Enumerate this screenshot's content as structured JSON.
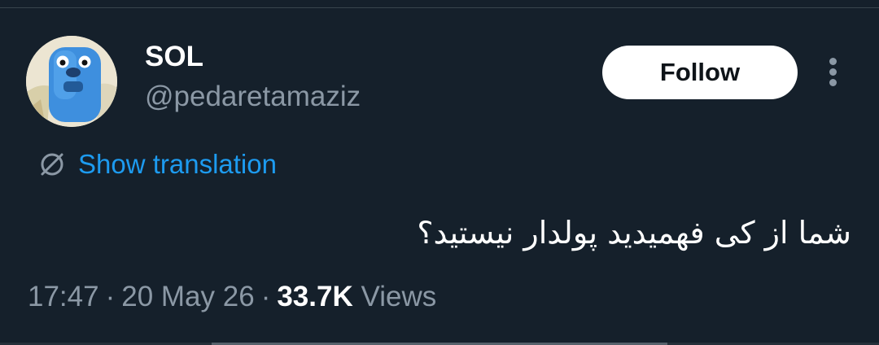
{
  "author": {
    "display_name": "SOL",
    "handle": "@pedaretamaziz"
  },
  "header": {
    "follow_label": "Follow",
    "more_icon": "more-vertical-icon"
  },
  "translation": {
    "icon": "translate-globe-icon",
    "label": "Show translation"
  },
  "tweet": {
    "text": "شما از کی فهمیدید پولدار نیستید؟"
  },
  "meta": {
    "time": "17:47",
    "separator": "·",
    "date": "20 May 26",
    "views_count": "33.7K",
    "views_label": "Views"
  },
  "colors": {
    "background": "#15202b",
    "accent_link": "#1d9bf0",
    "secondary_text": "#8b98a5",
    "primary_text": "#ffffff"
  }
}
